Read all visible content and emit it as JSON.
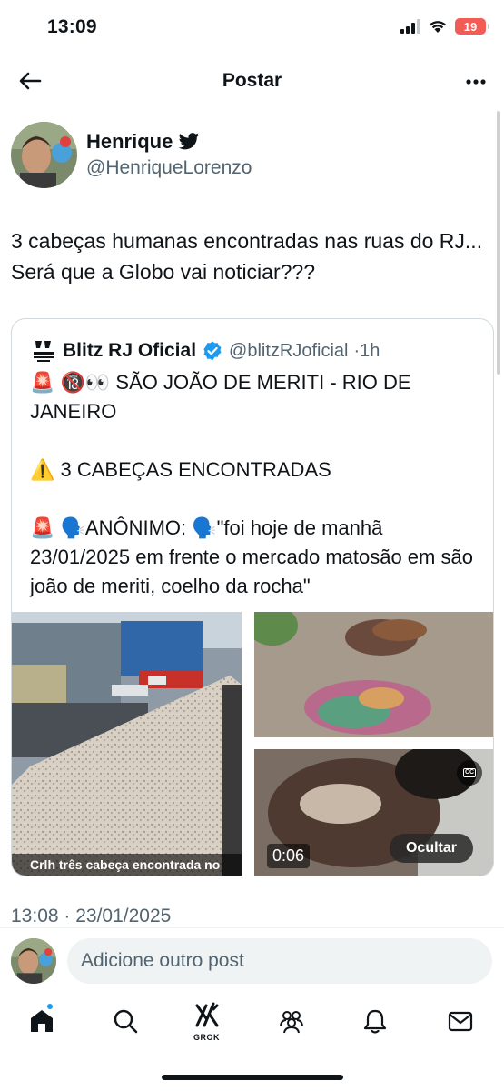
{
  "status_bar": {
    "time": "13:09",
    "battery": "19"
  },
  "header": {
    "title": "Postar"
  },
  "author": {
    "name": "Henrique",
    "handle": "@HenriqueLorenzo"
  },
  "post": {
    "text": "3 cabeças humanas encontradas nas ruas do RJ... Será que a Globo vai noticiar???",
    "timestamp": "13:08 · 23/01/2025"
  },
  "quoted": {
    "name": "Blitz RJ Oficial",
    "handle": "@blitzRJoficial",
    "age": "·1h",
    "text": "🚨 🔞👀 SÃO JOÃO DE MERITI - RIO DE JANEIRO\n\n⚠️ 3 CABEÇAS ENCONTRADAS\n\n🚨 🗣️ANÔNIMO: 🗣️\"foi hoje de manhã 23/01/2025 em frente o mercado matosão em são joão de meriti, coelho da rocha\"",
    "media": {
      "caption": "Crlh três cabeça encontrada no",
      "video_time": "0:06",
      "hide_label": "Ocultar"
    }
  },
  "reply": {
    "placeholder": "Adicione outro post"
  },
  "tabbar": {
    "grok_label": "GROK"
  },
  "colors": {
    "accent": "#1d9bf0",
    "text": "#0f1419",
    "secondary": "#536471",
    "battery": "#f25c54"
  }
}
